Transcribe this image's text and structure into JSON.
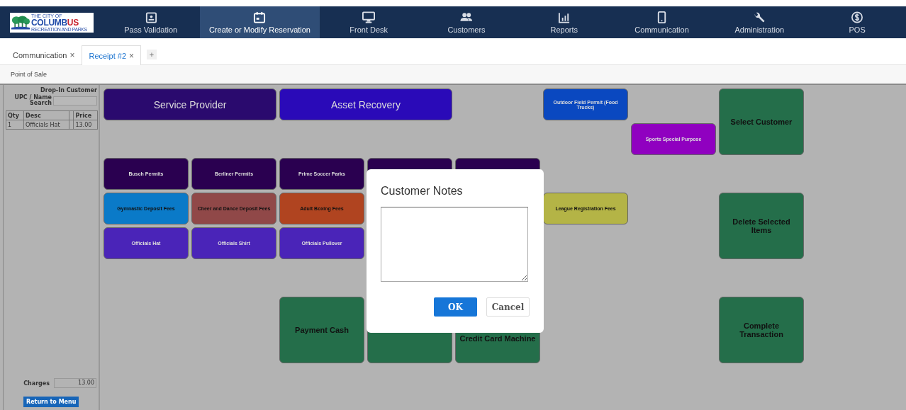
{
  "nav": {
    "logo": {
      "line1": "THE CITY OF",
      "line2a": "COLUMB",
      "line2b": "US",
      "line3": "RECREATION AND PARKS"
    },
    "items": [
      {
        "label": "Pass Validation",
        "selected": false
      },
      {
        "label": "Create or Modify Reservation",
        "selected": true
      },
      {
        "label": "Front Desk",
        "selected": false
      },
      {
        "label": "Customers",
        "selected": false
      },
      {
        "label": "Reports",
        "selected": false
      },
      {
        "label": "Communication",
        "selected": false
      },
      {
        "label": "Administration",
        "selected": false
      },
      {
        "label": "POS",
        "selected": false
      }
    ]
  },
  "tabs": [
    {
      "label": "Communication",
      "close": "×",
      "selected": false
    },
    {
      "label": "Receipt #2",
      "close": "×",
      "selected": true
    }
  ],
  "add_tab": "+",
  "breadcrumb": "Point of Sale",
  "sidebar": {
    "customer": "Drop-In Customer",
    "search_label": "UPC / Name Search",
    "columns": [
      "Qty",
      "Desc",
      "",
      "Price"
    ],
    "rows": [
      [
        "1",
        "Officials Hat",
        "",
        "13.00"
      ]
    ],
    "charges_label": "Charges",
    "charges": "13.00",
    "return_button": "Return to Menu"
  },
  "buttons": [
    {
      "label": "Service Provider",
      "color": "#2a0a6e",
      "kind": "large",
      "dark_text": false
    },
    {
      "label": "Asset Recovery",
      "color": "#2a0ab8",
      "kind": "large",
      "dark_text": false
    },
    {
      "label": "Outdoor Field Permit (Food Trucks)",
      "color": "#0a48c0",
      "kind": "small",
      "dark_text": false
    },
    {
      "label": "Sports Special Purpose",
      "color": "#9000c0",
      "kind": "small",
      "dark_text": false
    },
    {
      "label": "Select Customer",
      "color": "#246e4a",
      "kind": "action",
      "dark_text": true
    },
    {
      "label": "Busch Permits",
      "color": "#2a0050",
      "kind": "small",
      "dark_text": false
    },
    {
      "label": "Berliner Permits",
      "color": "#2a0050",
      "kind": "small",
      "dark_text": false
    },
    {
      "label": "Prime Soccer Parks",
      "color": "#2a0050",
      "kind": "small",
      "dark_text": false
    },
    {
      "color": "#2a0050",
      "kind": "small"
    },
    {
      "color": "#2a0050",
      "kind": "small"
    },
    {
      "label": "Gymnastic Deposit Fees",
      "color": "#0a7ac8",
      "kind": "small",
      "dark_text": true
    },
    {
      "label": "Cheer and Dance Deposit Fees",
      "color": "#904848",
      "kind": "small",
      "dark_text": true
    },
    {
      "label": "Adult Boxing Fees",
      "color": "#b04420",
      "kind": "small",
      "dark_text": true
    },
    {
      "label": "League Registration Fees",
      "color": "#b4b446",
      "kind": "small",
      "dark_text": true
    },
    {
      "label": "Delete Selected Items",
      "color": "#246e4a",
      "kind": "action",
      "dark_text": true
    },
    {
      "label": "Officials Hat",
      "color": "#4a24b8",
      "kind": "small",
      "dark_text": false
    },
    {
      "label": "Officials Shirt",
      "color": "#4a24b8",
      "kind": "small",
      "dark_text": false
    },
    {
      "label": "Officials Pullover",
      "color": "#4a24b8",
      "kind": "small",
      "dark_text": false
    },
    {
      "label": "Payment Cash",
      "color": "#246e4a",
      "kind": "action",
      "dark_text": true
    },
    {
      "color": "#246e4a",
      "kind": "action"
    },
    {
      "label": "Credit Card Machine",
      "color": "#246e4a",
      "kind": "action",
      "dark_text": true
    },
    {
      "label": "Complete Transaction",
      "color": "#246e4a",
      "kind": "action",
      "dark_text": true
    }
  ],
  "dialog": {
    "title": "Customer Notes",
    "ok": "OK",
    "cancel": "Cancel"
  }
}
